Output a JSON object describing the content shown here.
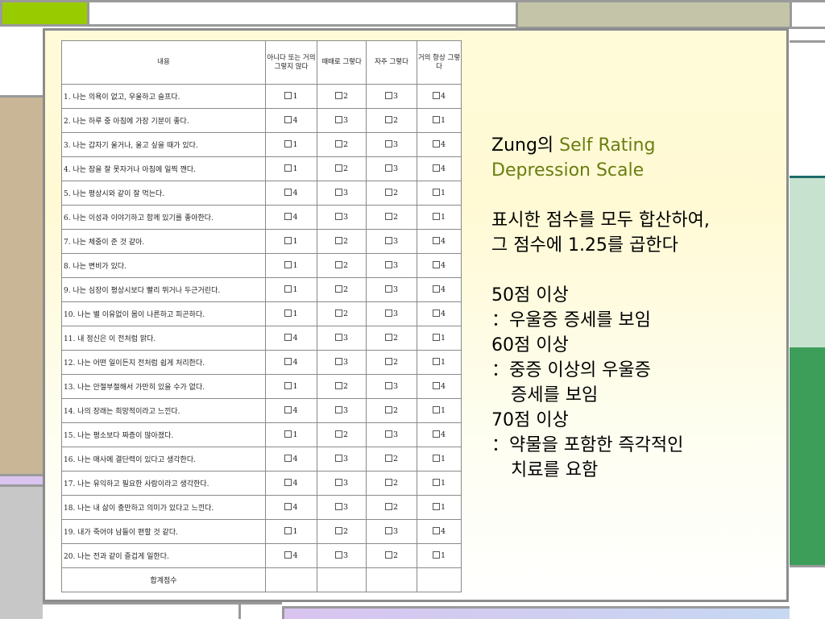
{
  "table": {
    "headers": [
      "내용",
      "아니다 또는 거의 그렇지 않다",
      "때때로 그렇다",
      "자주 그렇다",
      "거의 항상 그렇다"
    ],
    "rows": [
      {
        "text": "1. 나는 의욕이 없고, 우울하고 슬프다.",
        "scores": [
          "1",
          "2",
          "3",
          "4"
        ]
      },
      {
        "text": "2. 나는 하루 중 아침에 가장 기분이 좋다.",
        "scores": [
          "4",
          "3",
          "2",
          "1"
        ]
      },
      {
        "text": "3. 나는 갑자기 울거나, 울고 싶을 때가 있다.",
        "scores": [
          "1",
          "2",
          "3",
          "4"
        ]
      },
      {
        "text": "4. 나는 잠을 잘 못자거나 아침에 일찍 깬다.",
        "scores": [
          "1",
          "2",
          "3",
          "4"
        ]
      },
      {
        "text": "5. 나는 평상시와 같이 잘 먹는다.",
        "scores": [
          "4",
          "3",
          "2",
          "1"
        ]
      },
      {
        "text": "6. 나는 이성과 이야기하고 함께 있기를 좋아한다.",
        "scores": [
          "4",
          "3",
          "2",
          "1"
        ]
      },
      {
        "text": "7. 나는 체중이 준 것 같아.",
        "scores": [
          "1",
          "2",
          "3",
          "4"
        ]
      },
      {
        "text": "8. 나는 변비가 있다.",
        "scores": [
          "1",
          "2",
          "3",
          "4"
        ]
      },
      {
        "text": "9. 나는 심장이 평상시보다 빨리 뛰거나 두근거린다.",
        "scores": [
          "1",
          "2",
          "3",
          "4"
        ]
      },
      {
        "text": "10. 나는 별 이유없이 몸이 나른하고 피곤하다.",
        "scores": [
          "1",
          "2",
          "3",
          "4"
        ]
      },
      {
        "text": "11. 내 정신은 이 전처럼 맑다.",
        "scores": [
          "4",
          "3",
          "2",
          "1"
        ]
      },
      {
        "text": "12. 나는 어떤 일이든지 전처럼 쉽게 처리한다.",
        "scores": [
          "4",
          "3",
          "2",
          "1"
        ]
      },
      {
        "text": "13. 나는 안절부절해서 가만히 있을 수가 없다.",
        "scores": [
          "1",
          "2",
          "3",
          "4"
        ]
      },
      {
        "text": "14. 나의 장래는 희망적이라고 느낀다.",
        "scores": [
          "4",
          "3",
          "2",
          "1"
        ]
      },
      {
        "text": "15. 나는 평소보다 짜증이 많아졌다.",
        "scores": [
          "1",
          "2",
          "3",
          "4"
        ]
      },
      {
        "text": "16. 나는 매사에 결단력이 있다고 생각한다.",
        "scores": [
          "4",
          "3",
          "2",
          "1"
        ]
      },
      {
        "text": "17. 나는 유익하고 필요한 사람이라고 생각한다.",
        "scores": [
          "4",
          "3",
          "2",
          "1"
        ]
      },
      {
        "text": "18. 나는 내 삶이 충만하고 의미가 있다고 느낀다.",
        "scores": [
          "4",
          "3",
          "2",
          "1"
        ]
      },
      {
        "text": "19. 내가 죽어야 남들이 편할 것 같다.",
        "scores": [
          "1",
          "2",
          "3",
          "4"
        ]
      },
      {
        "text": "20. 나는 전과 같이 즐겁게 일한다.",
        "scores": [
          "4",
          "3",
          "2",
          "1"
        ]
      }
    ],
    "footer": "합계점수"
  },
  "side": {
    "title_plain": "Zung의",
    "title_accent_1": "Self Rating",
    "title_accent_2": "Depression Scale",
    "instruction_1": "표시한 점수를 모두 합산하여,",
    "instruction_2": "그 점수에 1.25를 곱한다",
    "t50_head": "50점 이상",
    "t50_desc": "：우울증 증세를 보임",
    "t60_head": "60점 이상",
    "t60_desc_1": "：중증 이상의 우울증",
    "t60_desc_2": "증세를 보임",
    "t70_head": "70점 이상",
    "t70_desc_1": "：약물을 포함한 즉각적인",
    "t70_desc_2": "치료를 요함"
  },
  "colors": {
    "accent_green_bar": "#99cc00",
    "frame_gray": "#9a9a9a",
    "olive_block": "#c4c4a8",
    "tan_block": "#c8b697",
    "pale_green_block": "#c7e3cf",
    "green_block": "#3d9e5a",
    "lavender_block": "#d9c4ef",
    "teal_line": "#1f6b6b",
    "title_accent": "#6b7d12"
  }
}
